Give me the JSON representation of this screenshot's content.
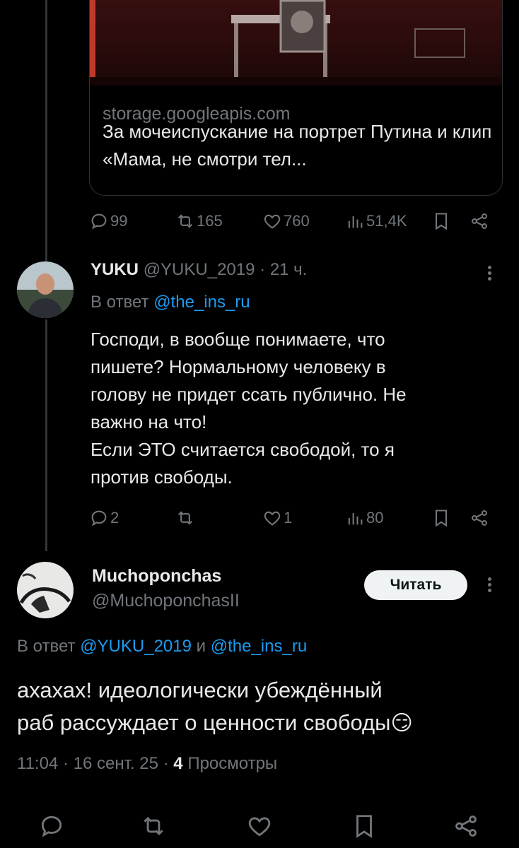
{
  "link_card": {
    "domain": "storage.googleapis.com",
    "title": "За мочеиспускание на портрет Путина и клип «Мама, не смотри тел..."
  },
  "quoted_tweet_stats": {
    "replies": "99",
    "retweets": "165",
    "likes": "760",
    "views": "51,4K"
  },
  "reply1": {
    "name": "YUKU",
    "handle": "@YUKU_2019",
    "time": "21 ч.",
    "reply_to_prefix": "В ответ",
    "reply_to_handle": "@the_ins_ru",
    "text_lines": [
      "Господи, в вообще понимаете, что",
      "пишете? Нормальному человеку в",
      "голову не придет ссать публично. Не",
      "важно на что!",
      "Если ЭТО считается свободой, то я",
      "против свободы."
    ],
    "stats": {
      "replies": "2",
      "retweets": "",
      "likes": "1",
      "views": "80"
    }
  },
  "reply2": {
    "name": "Muchoponchas",
    "handle": "@MuchoponchasII",
    "follow_label": "Читать",
    "reply_to_prefix": "В ответ",
    "reply_to_handle1": "@YUKU_2019",
    "reply_to_and": "и",
    "reply_to_handle2": "@the_ins_ru",
    "text_line1": "ахахах! идеологически убеждённый",
    "text_line2": "раб рассуждает о ценности свободы",
    "emoji": "😏",
    "time": "11:04",
    "date": "16 сент. 25",
    "views_count": "4",
    "views_label": "Просмотры"
  },
  "colors": {
    "accent": "#1d9bf0",
    "muted": "#71767b",
    "background": "#000000"
  }
}
